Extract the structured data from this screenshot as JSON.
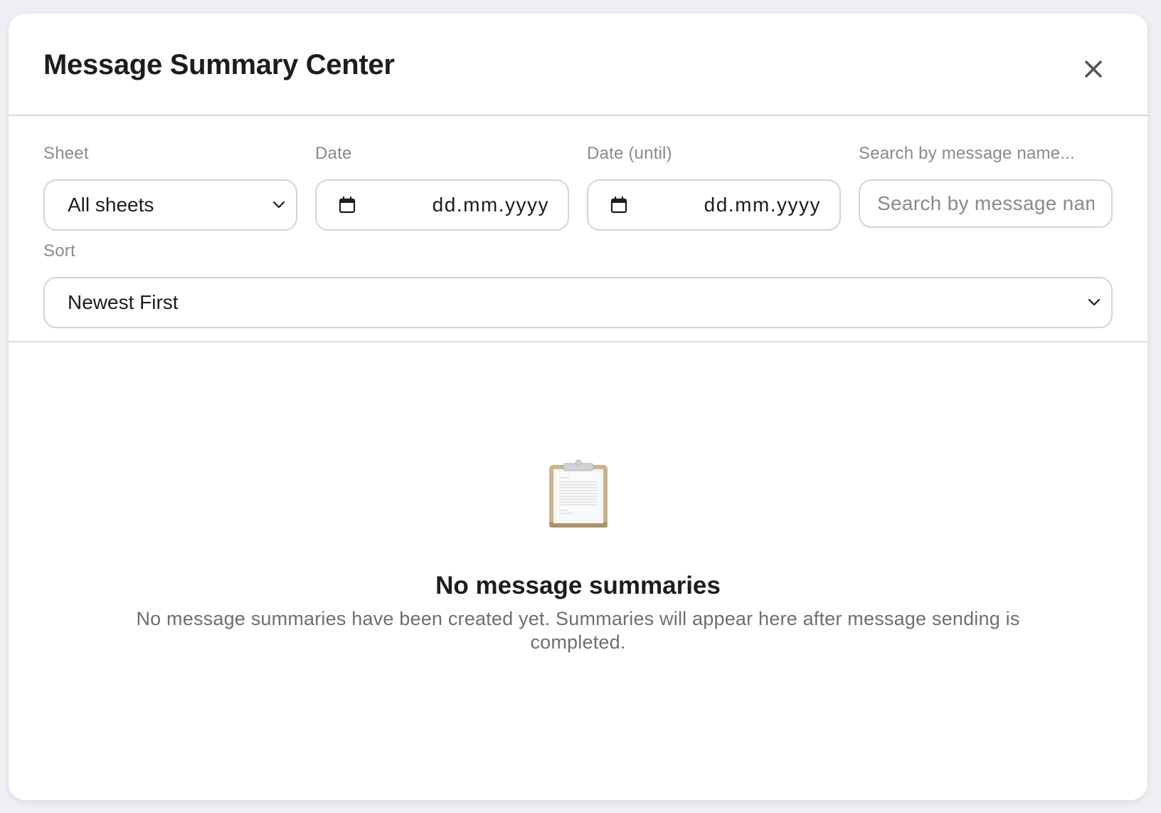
{
  "modal": {
    "title": "Message Summary Center",
    "close_icon": "close-icon"
  },
  "filters": {
    "sheet": {
      "label": "Sheet",
      "selected": "All sheets",
      "icon": "chevron-down-icon"
    },
    "date_from": {
      "label": "Date",
      "value": "dd.mm.yyyy",
      "icon": "calendar-icon"
    },
    "date_until": {
      "label": "Date (until)",
      "value": "dd.mm.yyyy",
      "icon": "calendar-icon"
    },
    "search": {
      "label": "Search by message name...",
      "placeholder": "Search by message name..."
    },
    "sort": {
      "label": "Sort",
      "selected": "Newest First",
      "icon": "chevron-down-icon"
    }
  },
  "empty_state": {
    "icon": "clipboard-icon",
    "title": "No message summaries",
    "description": "No message summaries have been created yet. Summaries will appear here after message sending is completed."
  },
  "colors": {
    "background": "#f0f0f4",
    "panel": "#ffffff",
    "border": "#d4d4d8",
    "muted_text": "#8a8a8e",
    "primary_text": "#1d1d1f"
  }
}
